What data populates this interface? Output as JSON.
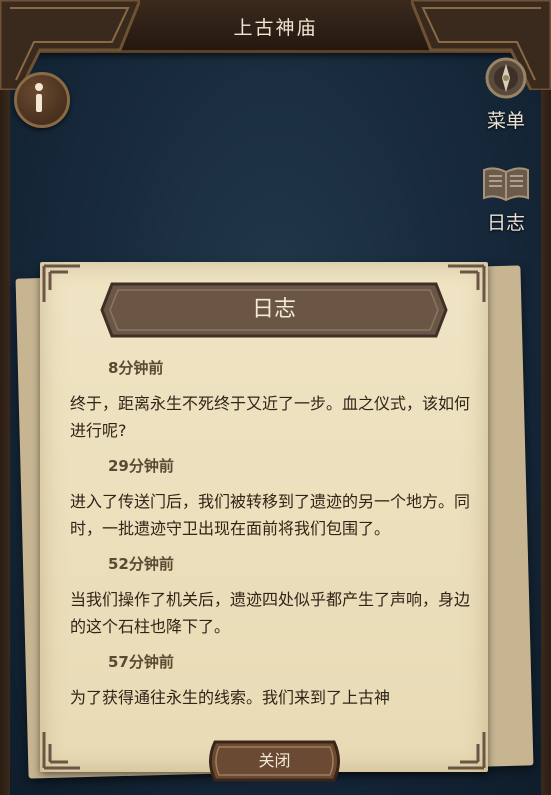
{
  "top_bar": {
    "title": "上古神庙"
  },
  "side_menu": {
    "menu_label": "菜单",
    "log_label": "日志"
  },
  "journal": {
    "title": "日志",
    "entries": [
      {
        "time": "8分钟前",
        "text": "终于，距离永生不死终于又近了一步。血之仪式，该如何进行呢?"
      },
      {
        "time": "29分钟前",
        "text": "进入了传送门后，我们被转移到了遗迹的另一个地方。同时，一批遗迹守卫出现在面前将我们包围了。"
      },
      {
        "time": "52分钟前",
        "text": "当我们操作了机关后，遗迹四处似乎都产生了声响，身边的这个石柱也降下了。"
      },
      {
        "time": "57分钟前",
        "text": "为了获得通往永生的线索。我们来到了上古神"
      }
    ],
    "close_label": "关闭"
  },
  "colors": {
    "background": "#16283a",
    "paper": "#ece0bd",
    "banner": "#6b5646",
    "frame": "#3a2a1e"
  },
  "icons": [
    "info-icon",
    "compass-icon",
    "book-icon"
  ]
}
